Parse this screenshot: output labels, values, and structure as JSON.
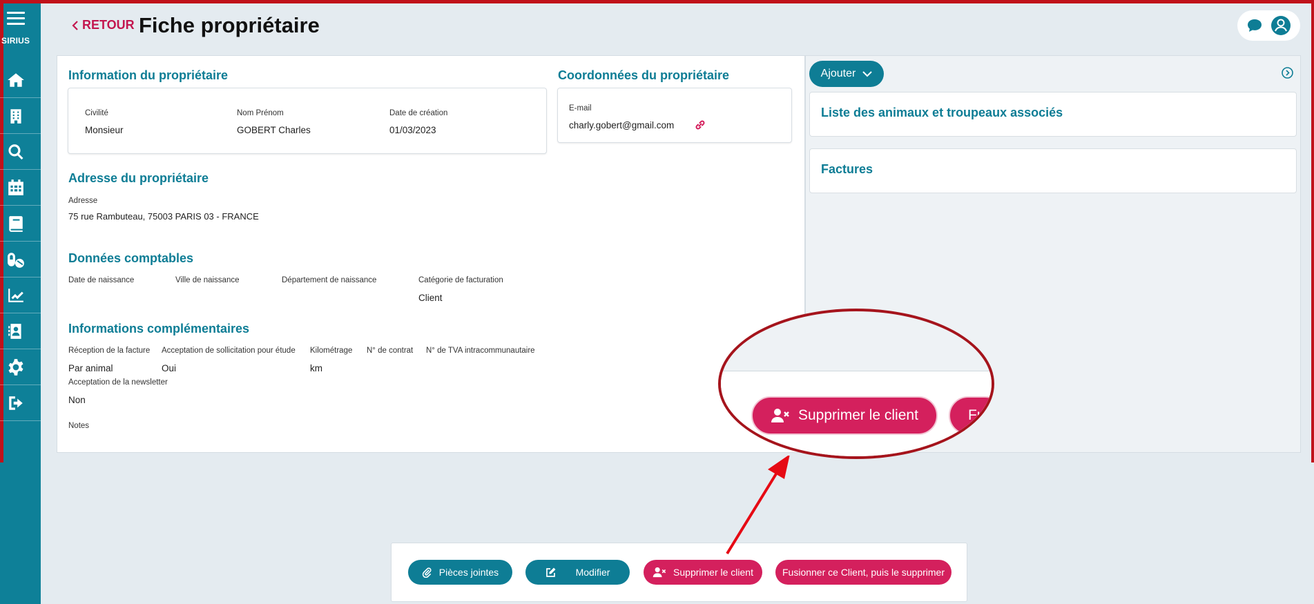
{
  "app": {
    "brand": "SIRIUS"
  },
  "header": {
    "back_label": "RETOUR",
    "title": "Fiche propriétaire"
  },
  "sidebar": {
    "items": [
      "home-icon",
      "building-icon",
      "search-icon",
      "calendar-icon",
      "book-icon",
      "pills-icon",
      "chart-line-icon",
      "contact-card-icon",
      "gear-icon",
      "logout-icon"
    ]
  },
  "owner_info": {
    "title": "Information du propriétaire",
    "civility_label": "Civilité",
    "civility": "Monsieur",
    "name_label": "Nom Prénom",
    "name": "GOBERT Charles",
    "created_label": "Date de création",
    "created": "01/03/2023"
  },
  "contact": {
    "title": "Coordonnées du propriétaire",
    "email_label": "E-mail",
    "email": "charly.gobert@gmail.com"
  },
  "address": {
    "title": "Adresse du propriétaire",
    "label": "Adresse",
    "value": "75 rue Rambuteau, 75003 PARIS 03 - FRANCE"
  },
  "accounting": {
    "title": "Données comptables",
    "birth_date_label": "Date de naissance",
    "birth_city_label": "Ville de naissance",
    "birth_dept_label": "Département de naissance",
    "billing_cat_label": "Catégorie de facturation",
    "billing_cat": "Client"
  },
  "extra": {
    "title": "Informations complémentaires",
    "invoice_label": "Réception de la facture",
    "invoice": "Par animal",
    "study_label": "Acceptation de sollicitation pour étude",
    "study": "Oui",
    "mileage_label": "Kilométrage",
    "mileage": "km",
    "contract_label": "N° de contrat",
    "vat_label": "N° de TVA intracommunautaire",
    "newsletter_label": "Acceptation de la newsletter",
    "newsletter": "Non",
    "notes_label": "Notes"
  },
  "right_panel": {
    "add_label": "Ajouter",
    "animals_title": "Liste des animaux et troupeaux associés",
    "invoices_title": "Factures"
  },
  "zoom": {
    "delete_label": "Supprimer le client",
    "merge_partial": "Fu"
  },
  "actions": {
    "attachments": "Pièces jointes",
    "edit": "Modifier",
    "delete": "Supprimer le client",
    "merge": "Fusionner ce Client, puis le supprimer"
  },
  "colors": {
    "teal": "#0e7d95",
    "pink": "#d4205d",
    "annotation_red": "#a5141c"
  }
}
